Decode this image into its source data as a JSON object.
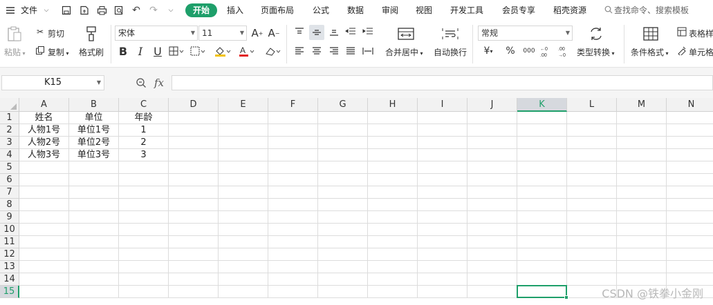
{
  "menubar": {
    "file": "文件",
    "tabs": [
      {
        "label": "开始",
        "active": true
      },
      {
        "label": "插入"
      },
      {
        "label": "页面布局"
      },
      {
        "label": "公式"
      },
      {
        "label": "数据"
      },
      {
        "label": "审阅"
      },
      {
        "label": "视图"
      },
      {
        "label": "开发工具"
      },
      {
        "label": "会员专享"
      },
      {
        "label": "稻壳资源"
      }
    ],
    "search_placeholder": "查找命令、搜索模板"
  },
  "ribbon": {
    "paste": "粘贴",
    "cut": "剪切",
    "copy": "复制",
    "format_painter": "格式刷",
    "font_name": "宋体",
    "font_size": "11",
    "merge_center": "合并居中",
    "wrap_text": "自动换行",
    "number_format": "常规",
    "convert_type": "类型转换",
    "conditional_format": "条件格式",
    "table_style": "表格样",
    "cell_style": "单元格"
  },
  "formula_bar": {
    "name_box": "K15",
    "fx": "fx",
    "value": ""
  },
  "grid": {
    "columns": [
      "A",
      "B",
      "C",
      "D",
      "E",
      "F",
      "G",
      "H",
      "I",
      "J",
      "K",
      "L",
      "M",
      "N"
    ],
    "selected_column": "K",
    "rows": [
      "1",
      "2",
      "3",
      "4",
      "5",
      "6",
      "7",
      "8",
      "9",
      "10",
      "11",
      "12",
      "13",
      "14",
      "15"
    ],
    "selected_row": "15",
    "active_cell": "K15",
    "data": [
      [
        "姓名",
        "单位",
        "年龄"
      ],
      [
        "人物1号",
        "单位1号",
        "1"
      ],
      [
        "人物2号",
        "单位2号",
        "2"
      ],
      [
        "人物3号",
        "单位3号",
        "3"
      ]
    ]
  },
  "watermark": "CSDN @铁拳小金刚",
  "colors": {
    "accent": "#1e9f6a"
  }
}
